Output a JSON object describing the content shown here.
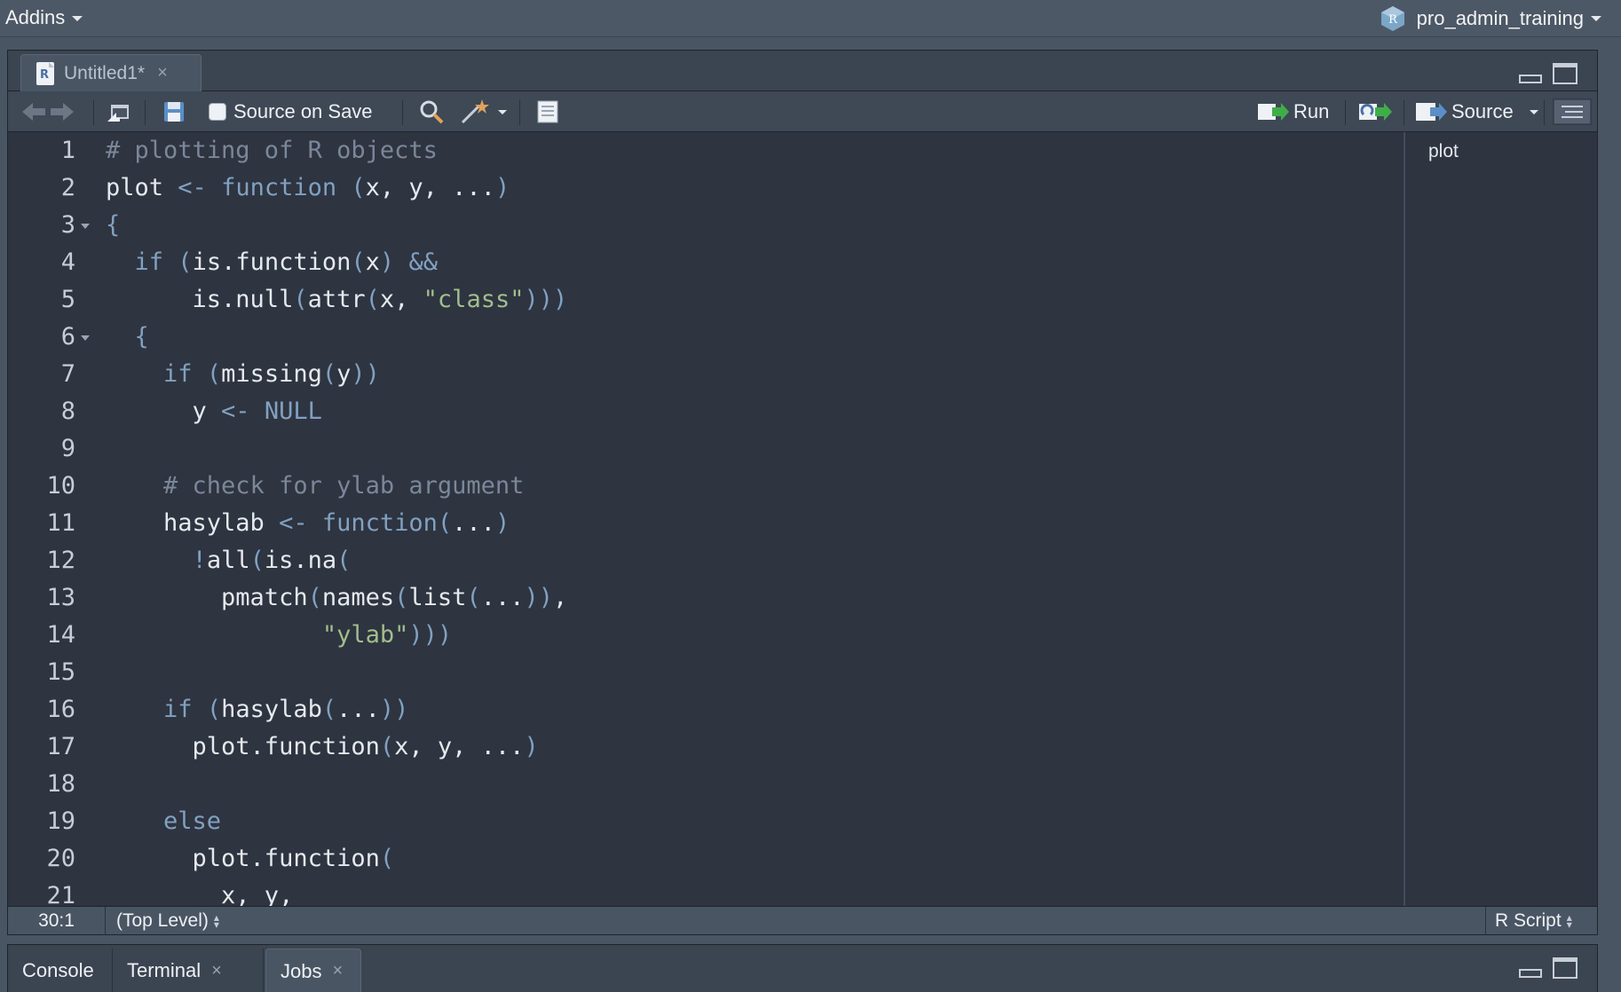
{
  "menubar": {
    "addins_label": "Addins",
    "project_label": "pro_admin_training",
    "r_badge": "R"
  },
  "editor_tab": {
    "label": "Untitled1*",
    "close": "×",
    "r_badge": "R"
  },
  "toolbar": {
    "source_on_save": "Source on Save",
    "run_label": "Run",
    "source_label": "Source"
  },
  "editor": {
    "lines": [
      {
        "n": "1",
        "tokens": [
          {
            "t": "# plotting of R objects",
            "c": "c"
          }
        ]
      },
      {
        "n": "2",
        "tokens": [
          {
            "t": "plot ",
            "c": ""
          },
          {
            "t": "<-",
            "c": "k"
          },
          {
            "t": " ",
            "c": ""
          },
          {
            "t": "function",
            "c": "k"
          },
          {
            "t": " ",
            "c": ""
          },
          {
            "t": "(",
            "c": "p"
          },
          {
            "t": "x, y, ...",
            "c": ""
          },
          {
            "t": ")",
            "c": "p"
          }
        ]
      },
      {
        "n": "3",
        "fold": true,
        "tokens": [
          {
            "t": "{",
            "c": "p"
          }
        ]
      },
      {
        "n": "4",
        "tokens": [
          {
            "t": "  ",
            "c": ""
          },
          {
            "t": "if",
            "c": "k"
          },
          {
            "t": " ",
            "c": ""
          },
          {
            "t": "(",
            "c": "p"
          },
          {
            "t": "is.function",
            "c": ""
          },
          {
            "t": "(",
            "c": "p"
          },
          {
            "t": "x",
            "c": ""
          },
          {
            "t": ")",
            "c": "p"
          },
          {
            "t": " ",
            "c": ""
          },
          {
            "t": "&&",
            "c": "k"
          }
        ]
      },
      {
        "n": "5",
        "tokens": [
          {
            "t": "      is.null",
            "c": ""
          },
          {
            "t": "(",
            "c": "p"
          },
          {
            "t": "attr",
            "c": ""
          },
          {
            "t": "(",
            "c": "p"
          },
          {
            "t": "x, ",
            "c": ""
          },
          {
            "t": "\"class\"",
            "c": "s"
          },
          {
            "t": ")))",
            "c": "p"
          }
        ]
      },
      {
        "n": "6",
        "fold": true,
        "tokens": [
          {
            "t": "  ",
            "c": ""
          },
          {
            "t": "{",
            "c": "p"
          }
        ]
      },
      {
        "n": "7",
        "tokens": [
          {
            "t": "    ",
            "c": ""
          },
          {
            "t": "if",
            "c": "k"
          },
          {
            "t": " ",
            "c": ""
          },
          {
            "t": "(",
            "c": "p"
          },
          {
            "t": "missing",
            "c": ""
          },
          {
            "t": "(",
            "c": "p"
          },
          {
            "t": "y",
            "c": ""
          },
          {
            "t": "))",
            "c": "p"
          }
        ]
      },
      {
        "n": "8",
        "tokens": [
          {
            "t": "      y ",
            "c": ""
          },
          {
            "t": "<-",
            "c": "k"
          },
          {
            "t": " ",
            "c": ""
          },
          {
            "t": "NULL",
            "c": "k"
          }
        ]
      },
      {
        "n": "9",
        "tokens": []
      },
      {
        "n": "10",
        "tokens": [
          {
            "t": "    ",
            "c": ""
          },
          {
            "t": "# check for ylab argument",
            "c": "c"
          }
        ]
      },
      {
        "n": "11",
        "tokens": [
          {
            "t": "    hasylab ",
            "c": ""
          },
          {
            "t": "<-",
            "c": "k"
          },
          {
            "t": " ",
            "c": ""
          },
          {
            "t": "function",
            "c": "k"
          },
          {
            "t": "(",
            "c": "p"
          },
          {
            "t": "...",
            "c": ""
          },
          {
            "t": ")",
            "c": "p"
          }
        ]
      },
      {
        "n": "12",
        "tokens": [
          {
            "t": "      ",
            "c": ""
          },
          {
            "t": "!",
            "c": "k"
          },
          {
            "t": "all",
            "c": ""
          },
          {
            "t": "(",
            "c": "p"
          },
          {
            "t": "is.na",
            "c": ""
          },
          {
            "t": "(",
            "c": "p"
          }
        ]
      },
      {
        "n": "13",
        "tokens": [
          {
            "t": "        pmatch",
            "c": ""
          },
          {
            "t": "(",
            "c": "p"
          },
          {
            "t": "names",
            "c": ""
          },
          {
            "t": "(",
            "c": "p"
          },
          {
            "t": "list",
            "c": ""
          },
          {
            "t": "(",
            "c": "p"
          },
          {
            "t": "...",
            "c": ""
          },
          {
            "t": "))",
            "c": "p"
          },
          {
            "t": ",",
            "c": ""
          }
        ]
      },
      {
        "n": "14",
        "tokens": [
          {
            "t": "               ",
            "c": ""
          },
          {
            "t": "\"ylab\"",
            "c": "s"
          },
          {
            "t": ")))",
            "c": "p"
          }
        ]
      },
      {
        "n": "15",
        "tokens": []
      },
      {
        "n": "16",
        "tokens": [
          {
            "t": "    ",
            "c": ""
          },
          {
            "t": "if",
            "c": "k"
          },
          {
            "t": " ",
            "c": ""
          },
          {
            "t": "(",
            "c": "p"
          },
          {
            "t": "hasylab",
            "c": ""
          },
          {
            "t": "(",
            "c": "p"
          },
          {
            "t": "...",
            "c": ""
          },
          {
            "t": "))",
            "c": "p"
          }
        ]
      },
      {
        "n": "17",
        "tokens": [
          {
            "t": "      plot.function",
            "c": ""
          },
          {
            "t": "(",
            "c": "p"
          },
          {
            "t": "x, y, ...",
            "c": ""
          },
          {
            "t": ")",
            "c": "p"
          }
        ]
      },
      {
        "n": "18",
        "tokens": []
      },
      {
        "n": "19",
        "tokens": [
          {
            "t": "    ",
            "c": ""
          },
          {
            "t": "else",
            "c": "k"
          }
        ]
      },
      {
        "n": "20",
        "tokens": [
          {
            "t": "      plot.function",
            "c": ""
          },
          {
            "t": "(",
            "c": "p"
          }
        ]
      },
      {
        "n": "21",
        "tokens": [
          {
            "t": "        x, y,",
            "c": ""
          }
        ]
      }
    ]
  },
  "outline": {
    "items": [
      "plot"
    ]
  },
  "status": {
    "cursor": "30:1",
    "scope": "(Top Level)",
    "file_type": "R Script"
  },
  "bottom_tabs": [
    {
      "label": "Console",
      "closable": false,
      "active": false
    },
    {
      "label": "Terminal",
      "closable": true,
      "active": false
    },
    {
      "label": "Jobs",
      "closable": true,
      "active": true
    }
  ],
  "icons": {
    "back": "back-arrow-icon",
    "forward": "forward-arrow-icon",
    "show_in_window": "show-in-window-icon",
    "save": "save-icon",
    "search": "search-icon",
    "code_tools": "magic-wand-icon",
    "compile_report": "notebook-icon",
    "rerun": "rerun-icon",
    "outline": "document-outline-icon"
  },
  "colors": {
    "keyword": "#81a1c1",
    "comment": "#7b8799",
    "string": "#a3be8c",
    "editor_bg": "#2e3440"
  }
}
